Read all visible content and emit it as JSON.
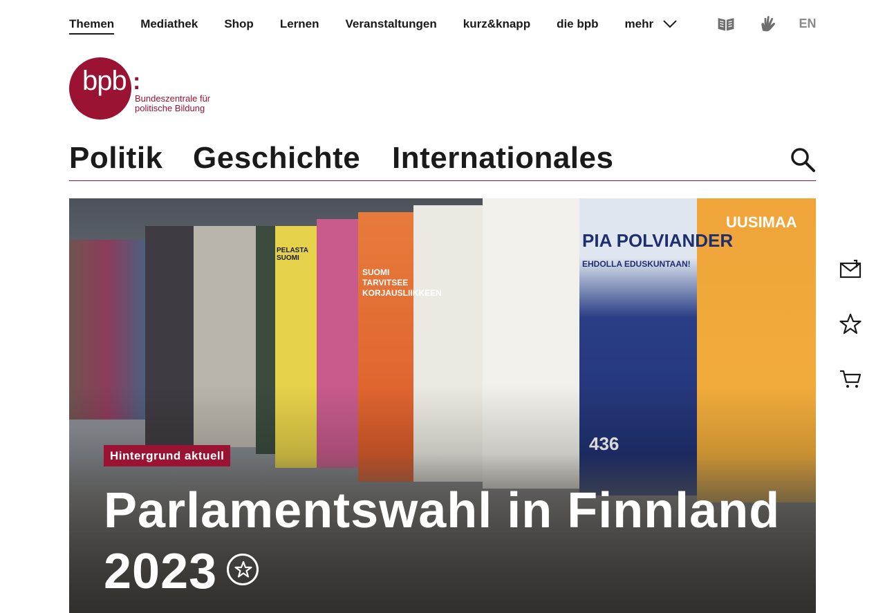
{
  "topnav": {
    "items": [
      {
        "label": "Themen",
        "active": true
      },
      {
        "label": "Mediathek",
        "active": false
      },
      {
        "label": "Shop",
        "active": false
      },
      {
        "label": "Lernen",
        "active": false
      },
      {
        "label": "Veranstaltungen",
        "active": false
      },
      {
        "label": "kurz&knapp",
        "active": false
      },
      {
        "label": "die bpb",
        "active": false
      }
    ],
    "more_label": "mehr",
    "language_label": "EN",
    "icons": [
      "easy-language-icon",
      "sign-language-icon",
      "chevron-down-icon"
    ]
  },
  "logo": {
    "mark": "bpb",
    "colon": ":",
    "line1": "Bundeszentrale für",
    "line2": "politische Bildung",
    "brand_color": "#9b1333"
  },
  "mainnav": {
    "items": [
      "Politik",
      "Geschichte",
      "Internationales"
    ],
    "search_icon": "search-icon"
  },
  "hero": {
    "badge": "Hintergrund aktuell",
    "title": "Parlamentswahl in Finnland 2023",
    "bookmark_icon": "star-icon",
    "image_alt_posters": {
      "p1": "PIA POLVIANDER",
      "p1_sub": "EHDOLLA EDUSKUNTAAN!",
      "p2": "UUSIMAA",
      "p3": "SUOMI TARVITSEE KORJAUSLIIKKEEN",
      "p4": "PELASTA SUOMI",
      "p5": "436"
    }
  },
  "rail": {
    "icons": [
      "newsletter-icon",
      "bookmark-star-icon",
      "cart-icon"
    ]
  }
}
